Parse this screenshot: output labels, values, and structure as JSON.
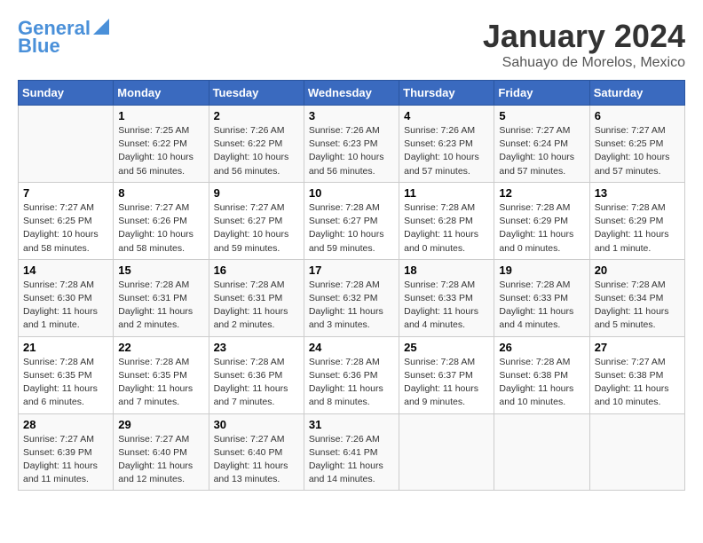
{
  "logo": {
    "line1": "General",
    "line2": "Blue"
  },
  "title": "January 2024",
  "subtitle": "Sahuayo de Morelos, Mexico",
  "weekdays": [
    "Sunday",
    "Monday",
    "Tuesday",
    "Wednesday",
    "Thursday",
    "Friday",
    "Saturday"
  ],
  "weeks": [
    [
      {
        "day": "",
        "info": ""
      },
      {
        "day": "1",
        "info": "Sunrise: 7:25 AM\nSunset: 6:22 PM\nDaylight: 10 hours\nand 56 minutes."
      },
      {
        "day": "2",
        "info": "Sunrise: 7:26 AM\nSunset: 6:22 PM\nDaylight: 10 hours\nand 56 minutes."
      },
      {
        "day": "3",
        "info": "Sunrise: 7:26 AM\nSunset: 6:23 PM\nDaylight: 10 hours\nand 56 minutes."
      },
      {
        "day": "4",
        "info": "Sunrise: 7:26 AM\nSunset: 6:23 PM\nDaylight: 10 hours\nand 57 minutes."
      },
      {
        "day": "5",
        "info": "Sunrise: 7:27 AM\nSunset: 6:24 PM\nDaylight: 10 hours\nand 57 minutes."
      },
      {
        "day": "6",
        "info": "Sunrise: 7:27 AM\nSunset: 6:25 PM\nDaylight: 10 hours\nand 57 minutes."
      }
    ],
    [
      {
        "day": "7",
        "info": "Sunrise: 7:27 AM\nSunset: 6:25 PM\nDaylight: 10 hours\nand 58 minutes."
      },
      {
        "day": "8",
        "info": "Sunrise: 7:27 AM\nSunset: 6:26 PM\nDaylight: 10 hours\nand 58 minutes."
      },
      {
        "day": "9",
        "info": "Sunrise: 7:27 AM\nSunset: 6:27 PM\nDaylight: 10 hours\nand 59 minutes."
      },
      {
        "day": "10",
        "info": "Sunrise: 7:28 AM\nSunset: 6:27 PM\nDaylight: 10 hours\nand 59 minutes."
      },
      {
        "day": "11",
        "info": "Sunrise: 7:28 AM\nSunset: 6:28 PM\nDaylight: 11 hours\nand 0 minutes."
      },
      {
        "day": "12",
        "info": "Sunrise: 7:28 AM\nSunset: 6:29 PM\nDaylight: 11 hours\nand 0 minutes."
      },
      {
        "day": "13",
        "info": "Sunrise: 7:28 AM\nSunset: 6:29 PM\nDaylight: 11 hours\nand 1 minute."
      }
    ],
    [
      {
        "day": "14",
        "info": "Sunrise: 7:28 AM\nSunset: 6:30 PM\nDaylight: 11 hours\nand 1 minute."
      },
      {
        "day": "15",
        "info": "Sunrise: 7:28 AM\nSunset: 6:31 PM\nDaylight: 11 hours\nand 2 minutes."
      },
      {
        "day": "16",
        "info": "Sunrise: 7:28 AM\nSunset: 6:31 PM\nDaylight: 11 hours\nand 2 minutes."
      },
      {
        "day": "17",
        "info": "Sunrise: 7:28 AM\nSunset: 6:32 PM\nDaylight: 11 hours\nand 3 minutes."
      },
      {
        "day": "18",
        "info": "Sunrise: 7:28 AM\nSunset: 6:33 PM\nDaylight: 11 hours\nand 4 minutes."
      },
      {
        "day": "19",
        "info": "Sunrise: 7:28 AM\nSunset: 6:33 PM\nDaylight: 11 hours\nand 4 minutes."
      },
      {
        "day": "20",
        "info": "Sunrise: 7:28 AM\nSunset: 6:34 PM\nDaylight: 11 hours\nand 5 minutes."
      }
    ],
    [
      {
        "day": "21",
        "info": "Sunrise: 7:28 AM\nSunset: 6:35 PM\nDaylight: 11 hours\nand 6 minutes."
      },
      {
        "day": "22",
        "info": "Sunrise: 7:28 AM\nSunset: 6:35 PM\nDaylight: 11 hours\nand 7 minutes."
      },
      {
        "day": "23",
        "info": "Sunrise: 7:28 AM\nSunset: 6:36 PM\nDaylight: 11 hours\nand 7 minutes."
      },
      {
        "day": "24",
        "info": "Sunrise: 7:28 AM\nSunset: 6:36 PM\nDaylight: 11 hours\nand 8 minutes."
      },
      {
        "day": "25",
        "info": "Sunrise: 7:28 AM\nSunset: 6:37 PM\nDaylight: 11 hours\nand 9 minutes."
      },
      {
        "day": "26",
        "info": "Sunrise: 7:28 AM\nSunset: 6:38 PM\nDaylight: 11 hours\nand 10 minutes."
      },
      {
        "day": "27",
        "info": "Sunrise: 7:27 AM\nSunset: 6:38 PM\nDaylight: 11 hours\nand 10 minutes."
      }
    ],
    [
      {
        "day": "28",
        "info": "Sunrise: 7:27 AM\nSunset: 6:39 PM\nDaylight: 11 hours\nand 11 minutes."
      },
      {
        "day": "29",
        "info": "Sunrise: 7:27 AM\nSunset: 6:40 PM\nDaylight: 11 hours\nand 12 minutes."
      },
      {
        "day": "30",
        "info": "Sunrise: 7:27 AM\nSunset: 6:40 PM\nDaylight: 11 hours\nand 13 minutes."
      },
      {
        "day": "31",
        "info": "Sunrise: 7:26 AM\nSunset: 6:41 PM\nDaylight: 11 hours\nand 14 minutes."
      },
      {
        "day": "",
        "info": ""
      },
      {
        "day": "",
        "info": ""
      },
      {
        "day": "",
        "info": ""
      }
    ]
  ]
}
